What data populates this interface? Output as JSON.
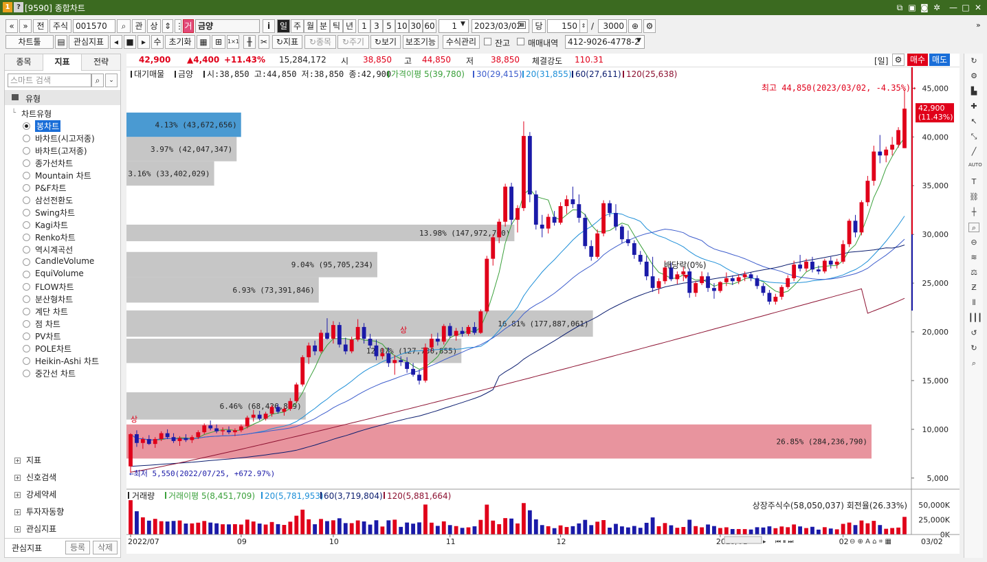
{
  "window": {
    "badge1": "1",
    "badge2": "?",
    "title": "[9590] 종합차트"
  },
  "toolbar1": {
    "nav_first": "«",
    "nav_prev": "»",
    "prev_label": "전",
    "stock_btn": "주식",
    "code_value": "001570",
    "kwan": "관",
    "sang": "상",
    "name_badge": "거",
    "name_value": "금양",
    "info": "i",
    "periods": [
      "일",
      "주",
      "월",
      "분",
      "틱",
      "년"
    ],
    "intervals": [
      "1",
      "3",
      "5",
      "10",
      "30",
      "60"
    ],
    "interval_select": "1",
    "date_value": "2023/03/02",
    "dang": "당",
    "count_value": "150",
    "slash": "/",
    "total_value": "3000"
  },
  "toolbar2": {
    "chart_tool": "차트툴",
    "interest": "관심지표",
    "su": "수",
    "reset": "초기화",
    "indicator": "지표",
    "jongmok": "종목",
    "jugi": "주기",
    "view": "보기",
    "aux": "보조기능",
    "formula": "수식관리",
    "balance_label": "잔고",
    "trade_label": "매매내역",
    "account_value": "412-9026-4778-2"
  },
  "quote": {
    "price": "42,900",
    "change": "▲4,400",
    "pct": "+11.43%",
    "volume": "15,284,172",
    "open_label": "시",
    "open": "38,850",
    "high_label": "고",
    "high": "44,850",
    "low_label": "저",
    "low": "38,850",
    "strength_label": "체결강도",
    "strength": "110.31",
    "day": "[일]",
    "buy": "매수",
    "sell": "매도"
  },
  "left": {
    "tabs": [
      "종목",
      "지표",
      "전략"
    ],
    "search_placeholder": "스마트 검색",
    "group_title": "유형",
    "tree_root": "차트유형",
    "items": [
      "봉차트",
      "바차트(시고저종)",
      "바차트(고저종)",
      "종가선차트",
      "Mountain 차트",
      "P&F차트",
      "삼선전환도",
      "Swing차트",
      "Kagi차트",
      "Renko차트",
      "역시계곡선",
      "CandleVolume",
      "EquiVolume",
      "FLOW차트",
      "분산형차트",
      "계단 차트",
      "점 차트",
      "PV차트",
      "POLE차트",
      "Heikin-Ashi 차트",
      "중간선 차트"
    ],
    "bottom_groups": [
      "지표",
      "신호검색",
      "강세약세",
      "투자자동향",
      "관심지표"
    ],
    "footer_label": "관심지표",
    "register": "등록",
    "delete": "삭제"
  },
  "chart": {
    "legend": {
      "vp": "대기매물",
      "name": "금양",
      "ohlc": "시:38,850 고:44,850 저:38,850 종:42,900",
      "ma5": "가격이평 5(39,780)",
      "ma30": "30(29,415)",
      "ma20": "20(31,855)",
      "ma60": "60(27,611)",
      "ma120": "120(25,638)"
    },
    "high_annot": "최고 44,850(2023/03/02, -4.35%)→",
    "low_annot": "←최저 5,550(2022/07/25, +672.97%)",
    "dividend": "배당락(0%)",
    "sang_marks": [
      "상",
      "상"
    ],
    "price_tag": "42,900",
    "price_tag_pct": "(11.43%)",
    "vol_legend": {
      "title": "거래량",
      "ma5": "거래이평 5(8,451,709)",
      "ma20": "20(5,781,953)",
      "ma60": "60(3,719,804)",
      "ma120": "120(5,881,664)"
    },
    "shares_info": "상장주식수(58,050,037) 회전율(26.33%)",
    "x_labels": [
      "2022/07",
      "09",
      "10",
      "11",
      "12",
      "2023/01",
      "02"
    ],
    "last_date": "03/02",
    "colors": {
      "up": "#e0001a",
      "down": "#1a1aa8",
      "ma5": "#3aa03a",
      "ma20": "#1e8fd8",
      "ma60": "#0a1c6e",
      "ma120": "#8c1030",
      "vp_gray": "#c6c6c6",
      "vp_blue": "#4a9ad2",
      "vp_pink": "#e8949e"
    }
  },
  "chart_data": {
    "type": "candlestick",
    "y_axis_ticks": [
      45000,
      40000,
      35000,
      30000,
      25000,
      20000,
      15000,
      10000,
      5000
    ],
    "ylim": [
      4000,
      47000
    ],
    "vol_axis_ticks": [
      "50,000K",
      "25,000K",
      "0K"
    ],
    "vol_ylim": [
      0,
      65000000
    ],
    "volume_profile": [
      {
        "low": 40000,
        "high": 42500,
        "label": "4.13% (43,672,656)",
        "pct": 4.13,
        "highlight": "current"
      },
      {
        "low": 37500,
        "high": 40000,
        "label": "3.97% (42,047,347)",
        "pct": 3.97
      },
      {
        "low": 35000,
        "high": 37500,
        "label": "3.16% (33,402,029)",
        "pct": 3.16
      },
      {
        "low": 29300,
        "high": 31000,
        "label": "13.98% (147,972,700)",
        "pct": 13.98
      },
      {
        "low": 25600,
        "high": 28200,
        "label": "9.04% (95,705,234)",
        "pct": 9.04
      },
      {
        "low": 23000,
        "high": 25600,
        "label": "6.93% (73,391,846)",
        "pct": 6.93
      },
      {
        "low": 19500,
        "high": 22200,
        "label": "16.81% (177,887,061)",
        "pct": 16.81
      },
      {
        "low": 16800,
        "high": 19300,
        "label": "12.07% (127,730,855)",
        "pct": 12.07
      },
      {
        "low": 11000,
        "high": 13800,
        "label": "6.46% (68,426,859)",
        "pct": 6.46
      },
      {
        "low": 7000,
        "high": 10500,
        "label": "26.85% (284,236,790)",
        "pct": 26.85,
        "highlight": "max"
      }
    ],
    "candles": [
      [
        6200,
        9600,
        5550,
        9500
      ],
      [
        9500,
        9900,
        8200,
        8600
      ],
      [
        8600,
        9200,
        8000,
        9000
      ],
      [
        9000,
        9400,
        8400,
        8500
      ],
      [
        8500,
        9200,
        8100,
        9000
      ],
      [
        9000,
        9800,
        8800,
        9600
      ],
      [
        9600,
        10000,
        9000,
        9200
      ],
      [
        9200,
        9600,
        8600,
        8800
      ],
      [
        8800,
        9300,
        8300,
        9100
      ],
      [
        9100,
        9500,
        8700,
        8900
      ],
      [
        8900,
        9400,
        8600,
        9200
      ],
      [
        9200,
        9900,
        9000,
        9700
      ],
      [
        9700,
        10600,
        9500,
        10400
      ],
      [
        10400,
        10900,
        9900,
        10100
      ],
      [
        10100,
        10500,
        9600,
        9800
      ],
      [
        9800,
        10200,
        9400,
        9900
      ],
      [
        9900,
        10300,
        9500,
        9700
      ],
      [
        9700,
        10100,
        9300,
        9900
      ],
      [
        9900,
        10500,
        9700,
        10300
      ],
      [
        10300,
        11400,
        10100,
        11200
      ],
      [
        11200,
        12000,
        10800,
        11500
      ],
      [
        11500,
        11900,
        10900,
        11100
      ],
      [
        11100,
        11800,
        10900,
        11600
      ],
      [
        11600,
        12500,
        11300,
        12300
      ],
      [
        12300,
        12600,
        11600,
        11800
      ],
      [
        11800,
        12300,
        11400,
        12100
      ],
      [
        12100,
        13200,
        11900,
        12900
      ],
      [
        12900,
        14800,
        12700,
        14600
      ],
      [
        14600,
        17600,
        14400,
        17400
      ],
      [
        17400,
        18900,
        16700,
        18600
      ],
      [
        18600,
        19100,
        17600,
        18000
      ],
      [
        18000,
        20200,
        17800,
        19900
      ],
      [
        19900,
        21400,
        19200,
        19300
      ],
      [
        19300,
        21100,
        18800,
        20700
      ],
      [
        20700,
        21000,
        18400,
        18700
      ],
      [
        18700,
        19400,
        17700,
        18000
      ],
      [
        18000,
        19500,
        17800,
        19200
      ],
      [
        19200,
        21300,
        19000,
        20500
      ],
      [
        20500,
        20900,
        18800,
        19300
      ],
      [
        19300,
        19800,
        18300,
        18600
      ],
      [
        18600,
        19200,
        17100,
        17500
      ],
      [
        17500,
        18300,
        17200,
        17800
      ],
      [
        17800,
        18400,
        16400,
        16800
      ],
      [
        16800,
        17600,
        15600,
        17100
      ],
      [
        17100,
        17500,
        16500,
        16900
      ],
      [
        16900,
        17400,
        15800,
        16200
      ],
      [
        16200,
        16800,
        15400,
        15600
      ],
      [
        15600,
        16100,
        14600,
        15000
      ],
      [
        15000,
        18800,
        14800,
        18400
      ],
      [
        18400,
        19800,
        18000,
        19300
      ],
      [
        19300,
        19900,
        18600,
        19000
      ],
      [
        19000,
        20800,
        18700,
        20600
      ],
      [
        20600,
        20900,
        19400,
        19600
      ],
      [
        19600,
        20400,
        19100,
        20100
      ],
      [
        20100,
        20500,
        19500,
        19800
      ],
      [
        19800,
        20700,
        19600,
        20500
      ],
      [
        20500,
        21000,
        19700,
        19900
      ],
      [
        19900,
        22300,
        19800,
        22100
      ],
      [
        22100,
        27800,
        21900,
        27500
      ],
      [
        27500,
        30000,
        26800,
        29700
      ],
      [
        29700,
        31600,
        29100,
        31300
      ],
      [
        31300,
        35200,
        30800,
        34900
      ],
      [
        34900,
        35300,
        31000,
        31500
      ],
      [
        31500,
        33000,
        30200,
        32700
      ],
      [
        32700,
        41600,
        32400,
        40100
      ],
      [
        40100,
        40500,
        33300,
        34100
      ],
      [
        34100,
        34500,
        30500,
        31000
      ],
      [
        31000,
        32000,
        29700,
        30600
      ],
      [
        30600,
        32100,
        30100,
        31800
      ],
      [
        31800,
        32400,
        30900,
        31200
      ],
      [
        31200,
        33300,
        31000,
        32900
      ],
      [
        32900,
        34000,
        32100,
        33600
      ],
      [
        33600,
        34900,
        32700,
        33100
      ],
      [
        33100,
        34100,
        31200,
        31700
      ],
      [
        31700,
        32100,
        28500,
        28800
      ],
      [
        28800,
        29400,
        27300,
        27700
      ],
      [
        27700,
        30500,
        27500,
        30100
      ],
      [
        30100,
        33500,
        29800,
        33200
      ],
      [
        33200,
        33500,
        31800,
        32200
      ],
      [
        32200,
        33100,
        30400,
        30800
      ],
      [
        30800,
        31000,
        29100,
        29500
      ],
      [
        29500,
        30400,
        28800,
        29100
      ],
      [
        29100,
        29400,
        27500,
        27900
      ],
      [
        27900,
        28300,
        26900,
        27200
      ],
      [
        27200,
        27800,
        25300,
        25700
      ],
      [
        25700,
        27700,
        24100,
        24500
      ],
      [
        24500,
        25500,
        23900,
        25200
      ],
      [
        25200,
        27300,
        24900,
        26600
      ],
      [
        26600,
        27100,
        25200,
        25400
      ],
      [
        25400,
        26200,
        24900,
        25900
      ],
      [
        25900,
        26700,
        25200,
        26200
      ],
      [
        26200,
        26500,
        23500,
        24000
      ],
      [
        24000,
        25200,
        23600,
        25000
      ],
      [
        25000,
        26200,
        24800,
        25700
      ],
      [
        25700,
        26100,
        24100,
        24500
      ],
      [
        24500,
        25000,
        23400,
        24200
      ],
      [
        24200,
        25200,
        24000,
        25100
      ],
      [
        25100,
        26100,
        24700,
        25500
      ],
      [
        25500,
        25800,
        24800,
        25200
      ],
      [
        25200,
        25900,
        24900,
        25600
      ],
      [
        25600,
        26200,
        25200,
        25900
      ],
      [
        25900,
        26100,
        25200,
        25500
      ],
      [
        25500,
        25800,
        24400,
        24700
      ],
      [
        24700,
        25000,
        23700,
        24000
      ],
      [
        24000,
        24300,
        22800,
        23100
      ],
      [
        23100,
        23900,
        22800,
        23600
      ],
      [
        23600,
        24800,
        23300,
        24600
      ],
      [
        24600,
        25800,
        24400,
        25500
      ],
      [
        25500,
        27300,
        25200,
        26900
      ],
      [
        26900,
        27900,
        26200,
        26500
      ],
      [
        26500,
        27500,
        26200,
        27200
      ],
      [
        27200,
        27700,
        26100,
        26400
      ],
      [
        26400,
        26800,
        25900,
        26200
      ],
      [
        26200,
        27500,
        26000,
        27300
      ],
      [
        27300,
        27700,
        26500,
        26900
      ],
      [
        26900,
        27500,
        26500,
        27200
      ],
      [
        27200,
        29400,
        27000,
        29000
      ],
      [
        29000,
        31600,
        28700,
        31400
      ],
      [
        31400,
        32000,
        29700,
        30200
      ],
      [
        30200,
        33500,
        29900,
        33300
      ],
      [
        33300,
        36000,
        32900,
        35500
      ],
      [
        35500,
        39100,
        35000,
        38500
      ],
      [
        38500,
        40200,
        37300,
        38100
      ],
      [
        38100,
        39000,
        37400,
        38700
      ],
      [
        38700,
        40000,
        38100,
        39200
      ],
      [
        39200,
        41000,
        38900,
        40700
      ],
      [
        38850,
        44850,
        38850,
        42900
      ]
    ],
    "ma5_endpoint": 39780,
    "ma20_endpoint": 31855,
    "ma30_endpoint": 29415,
    "ma60_endpoint": 27611,
    "ma120_endpoint": 25638
  }
}
